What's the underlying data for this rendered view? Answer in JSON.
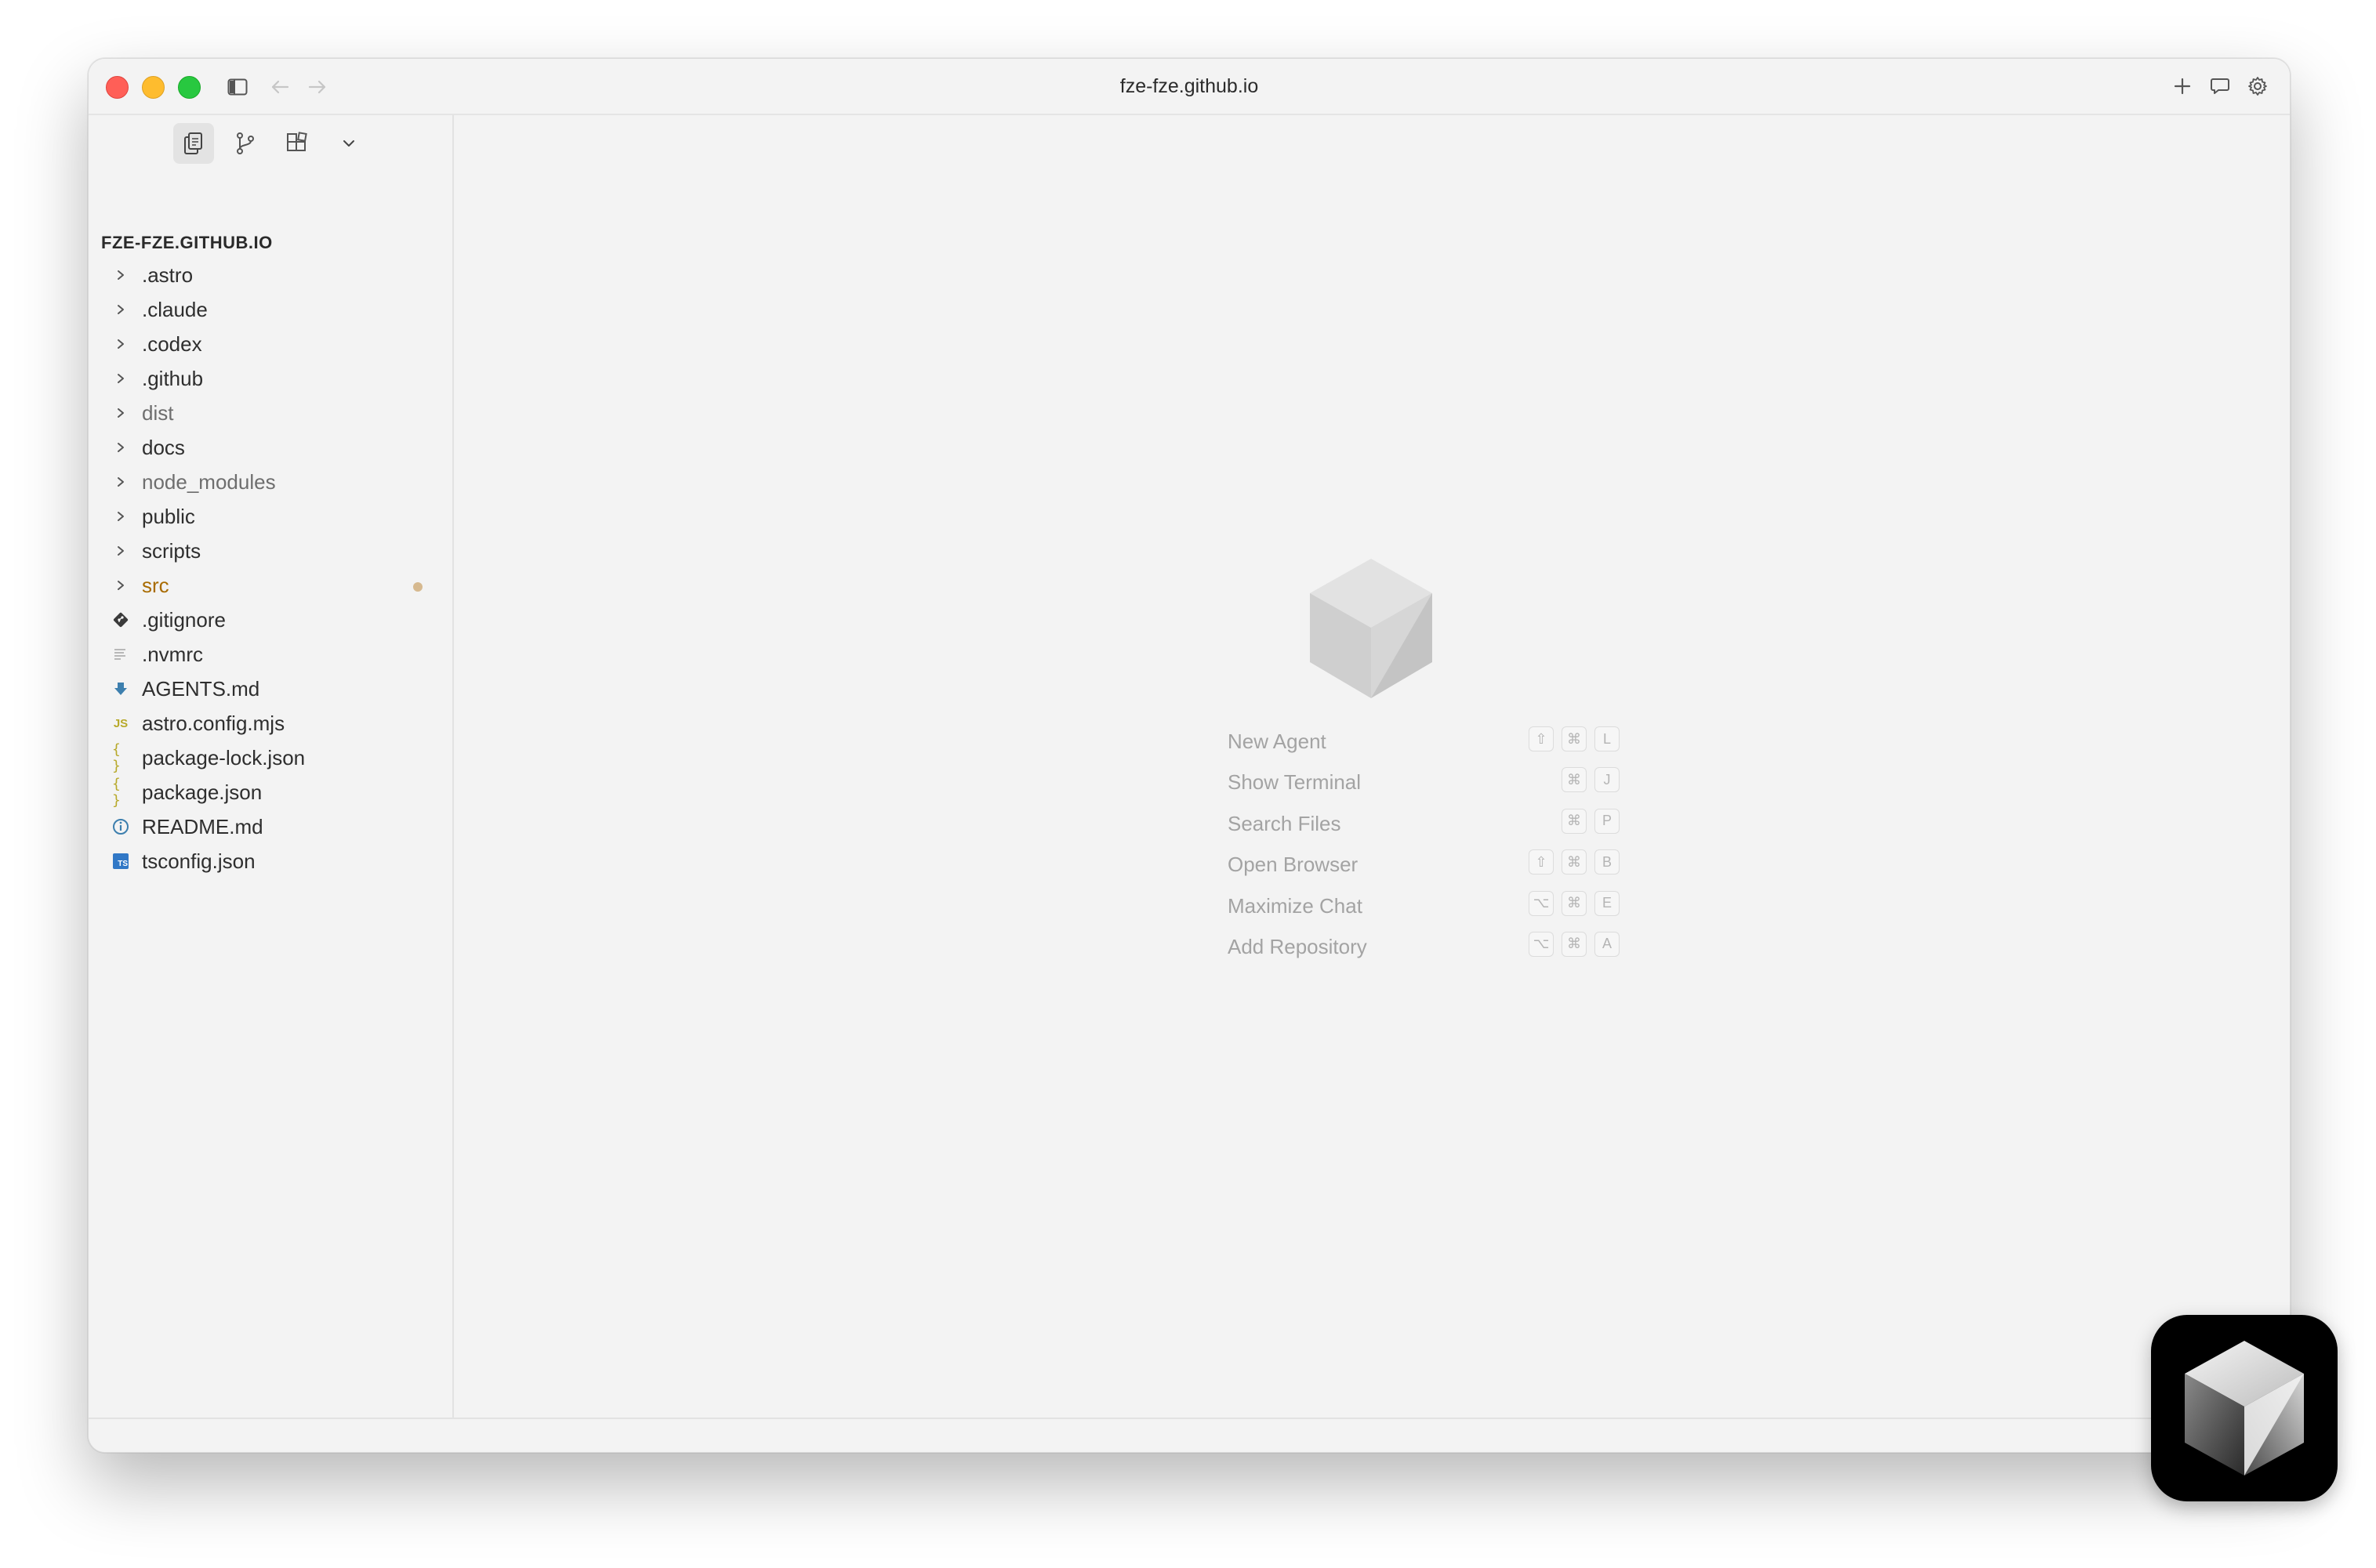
{
  "window": {
    "title": "fze-fze.github.io"
  },
  "toolbar": {
    "icons": [
      "sidebar-toggle-icon",
      "back-arrow-icon",
      "forward-arrow-icon",
      "plus-icon",
      "chat-icon",
      "gear-icon"
    ]
  },
  "sidebar": {
    "tabs": [
      {
        "icon": "files-icon",
        "active": true
      },
      {
        "icon": "source-control-icon",
        "active": false
      },
      {
        "icon": "extensions-icon",
        "active": false
      },
      {
        "icon": "chevron-down-icon",
        "active": false
      }
    ],
    "project_title": "FZE-FZE.GITHUB.IO",
    "items": [
      {
        "name": ".astro",
        "type": "folder"
      },
      {
        "name": ".claude",
        "type": "folder"
      },
      {
        "name": ".codex",
        "type": "folder"
      },
      {
        "name": ".github",
        "type": "folder"
      },
      {
        "name": "dist",
        "type": "folder",
        "muted": true
      },
      {
        "name": "docs",
        "type": "folder"
      },
      {
        "name": "node_modules",
        "type": "folder",
        "muted": true
      },
      {
        "name": "public",
        "type": "folder"
      },
      {
        "name": "scripts",
        "type": "folder"
      },
      {
        "name": "src",
        "type": "folder",
        "modified": true
      },
      {
        "name": ".gitignore",
        "type": "file",
        "icon": "git-icon"
      },
      {
        "name": ".nvmrc",
        "type": "file",
        "icon": "text-lines-icon"
      },
      {
        "name": "AGENTS.md",
        "type": "file",
        "icon": "markdown-arrow-icon"
      },
      {
        "name": "astro.config.mjs",
        "type": "file",
        "icon": "js-icon",
        "icon_text": "JS"
      },
      {
        "name": "package-lock.json",
        "type": "file",
        "icon": "json-braces-icon",
        "icon_text": "{ }"
      },
      {
        "name": "package.json",
        "type": "file",
        "icon": "json-braces-icon",
        "icon_text": "{ }"
      },
      {
        "name": "README.md",
        "type": "file",
        "icon": "info-icon"
      },
      {
        "name": "tsconfig.json",
        "type": "file",
        "icon": "ts-icon",
        "icon_text": "TS"
      }
    ]
  },
  "main": {
    "shortcuts": [
      {
        "label": "New Agent",
        "keys": [
          "⇧",
          "⌘",
          "L"
        ]
      },
      {
        "label": "Show Terminal",
        "keys": [
          "",
          "⌘",
          "J"
        ]
      },
      {
        "label": "Search Files",
        "keys": [
          "",
          "⌘",
          "P"
        ]
      },
      {
        "label": "Open Browser",
        "keys": [
          "⇧",
          "⌘",
          "B"
        ]
      },
      {
        "label": "Maximize Chat",
        "keys": [
          "⌥",
          "⌘",
          "E"
        ]
      },
      {
        "label": "Add Repository",
        "keys": [
          "⌥",
          "⌘",
          "A"
        ]
      }
    ]
  },
  "colors": {
    "modified": "#a86b00",
    "js": "#b7a92a",
    "json": "#b7a92a",
    "ts": "#3178c6",
    "markdown": "#3d7fae"
  }
}
